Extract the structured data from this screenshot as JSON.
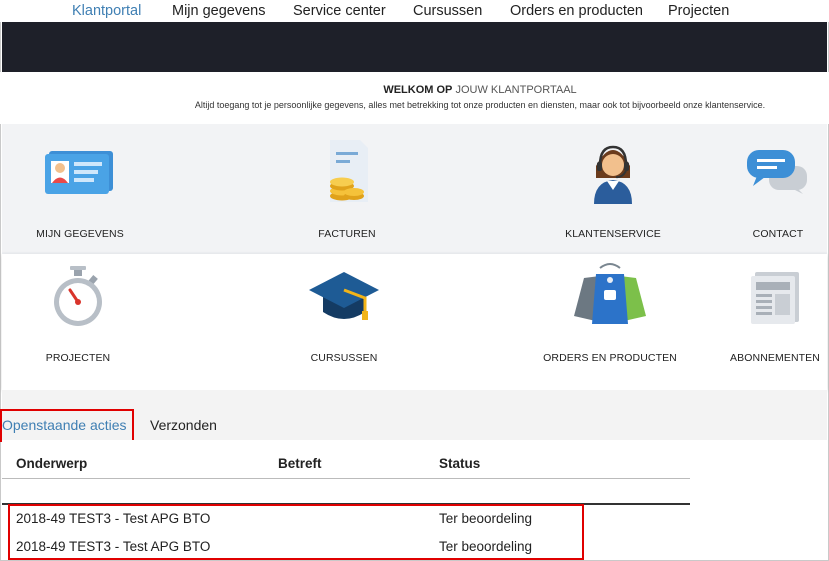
{
  "nav": {
    "items": [
      {
        "label": "Klantportal",
        "active": true
      },
      {
        "label": "Mijn gegevens",
        "active": false
      },
      {
        "label": "Service center",
        "active": false
      },
      {
        "label": "Cursussen",
        "active": false
      },
      {
        "label": "Orders en producten",
        "active": false
      },
      {
        "label": "Projecten",
        "active": false
      }
    ]
  },
  "welcome": {
    "title_bold": "WELKOM OP",
    "title_light": "JOUW KLANTPORTAAL",
    "subtitle": "Altijd toegang tot je persoonlijke gegevens, alles met betrekking tot onze producten en diensten, maar ook tot bijvoorbeeld onze klantenservice."
  },
  "tiles": [
    {
      "label": "MIJN GEGEVENS",
      "icon": "id-card-icon"
    },
    {
      "label": "FACTUREN",
      "icon": "invoice-coins-icon"
    },
    {
      "label": "KLANTENSERVICE",
      "icon": "headset-agent-icon"
    },
    {
      "label": "CONTACT",
      "icon": "chat-bubbles-icon"
    },
    {
      "label": "PROJECTEN",
      "icon": "stopwatch-icon"
    },
    {
      "label": "CURSUSSEN",
      "icon": "graduation-cap-icon"
    },
    {
      "label": "ORDERS EN PRODUCTEN",
      "icon": "price-tags-icon"
    },
    {
      "label": "ABONNEMENTEN",
      "icon": "newspaper-icon"
    }
  ],
  "tabs": {
    "open": "Openstaande acties",
    "sent": "Verzonden"
  },
  "table": {
    "headers": {
      "subject": "Onderwerp",
      "regarding": "Betreft",
      "status": "Status"
    },
    "rows": [
      {
        "subject": "2018-49 TEST3 - Test APG BTO",
        "regarding": "",
        "status": "Ter beoordeling"
      },
      {
        "subject": "2018-49 TEST3 - Test APG BTO",
        "regarding": "",
        "status": "Ter beoordeling"
      }
    ]
  },
  "colors": {
    "accent": "#3f7fb3",
    "highlight": "#e00000",
    "hero": "#1e2029"
  }
}
